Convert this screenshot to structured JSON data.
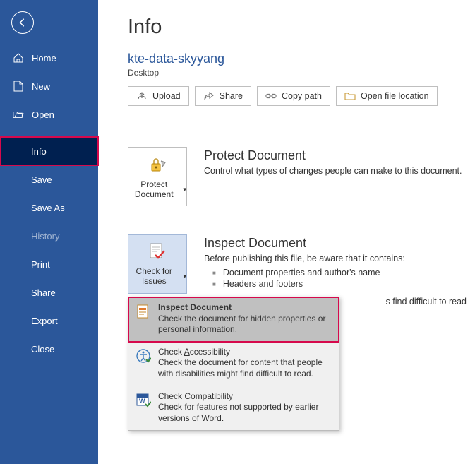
{
  "sidebar": {
    "home": "Home",
    "new": "New",
    "open": "Open",
    "info": "Info",
    "save": "Save",
    "saveas": "Save As",
    "history": "History",
    "print": "Print",
    "share": "Share",
    "export": "Export",
    "close": "Close"
  },
  "main": {
    "title": "Info",
    "docname": "kte-data-skyyang",
    "doclocation": "Desktop",
    "buttons": {
      "upload": "Upload",
      "share": "Share",
      "copypath": "Copy path",
      "openloc": "Open file location"
    },
    "protect": {
      "btn": "Protect Document",
      "title": "Protect Document",
      "desc": "Control what types of changes people can make to this document."
    },
    "inspect": {
      "btn": "Check for Issues",
      "title": "Inspect Document",
      "desc": "Before publishing this file, be aware that it contains:",
      "b1": "Document properties and author's name",
      "b2": "Headers and footers",
      "b3_tail": "s find difficult to read"
    },
    "menu": {
      "i1_title_pre": "Inspect ",
      "i1_title_u": "D",
      "i1_title_post": "ocument",
      "i1_desc": "Check the document for hidden properties or personal information.",
      "i2_title_pre": "Check ",
      "i2_title_u": "A",
      "i2_title_post": "ccessibility",
      "i2_desc": "Check the document for content that people with disabilities might find difficult to read.",
      "i3_title_pre": "Check Compa",
      "i3_title_u": "t",
      "i3_title_post": "ibility",
      "i3_desc": "Check for features not supported by earlier versions of Word."
    }
  }
}
